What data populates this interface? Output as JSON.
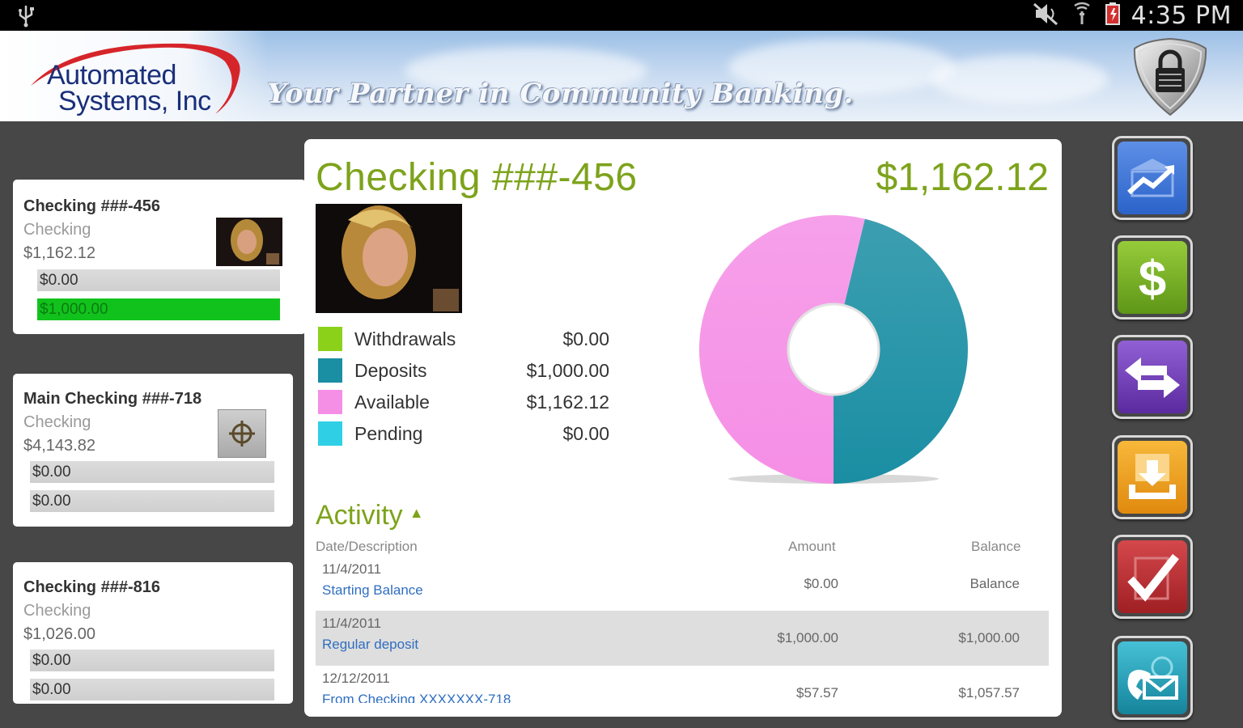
{
  "status_bar": {
    "time": "4:35 PM",
    "icons": [
      "usb-icon",
      "mute-icon",
      "signal-icon",
      "battery-icon"
    ]
  },
  "header": {
    "logo_line1": "Automated",
    "logo_line2": "Systems, Inc",
    "tagline": "Your Partner in Community Banking.",
    "lock_icon": "lock-shield-icon"
  },
  "accounts": [
    {
      "name": "Checking ###-456",
      "type": "Checking",
      "balance": "$1,162.12",
      "bar1": "$0.00",
      "bar2": "$1,000.00",
      "bar2_color": "#12c21c"
    },
    {
      "name": "Main Checking ###-718",
      "type": "Checking",
      "balance": "$4,143.82",
      "bar1": "$0.00",
      "bar2": "$0.00"
    },
    {
      "name": "Checking ###-816",
      "type": "Checking",
      "balance": "$1,026.00",
      "bar1": "$0.00",
      "bar2": "$0.00"
    }
  ],
  "detail": {
    "title": "Checking ###-456",
    "amount": "$1,162.12",
    "accent_color": "#7da31b",
    "legend": [
      {
        "label": "Withdrawals",
        "value": "$0.00",
        "color": "#8bd11a"
      },
      {
        "label": "Deposits",
        "value": "$1,000.00",
        "color": "#1a8ea3"
      },
      {
        "label": "Available",
        "value": "$1,162.12",
        "color": "#f58fe6"
      },
      {
        "label": "Pending",
        "value": "$0.00",
        "color": "#2fd0e6"
      }
    ]
  },
  "chart_data": {
    "type": "pie",
    "series": [
      {
        "name": "Deposits",
        "value": 1000.0,
        "color": "#1a8ea3"
      },
      {
        "name": "Available",
        "value": 1162.12,
        "color": "#f58fe6"
      }
    ],
    "donut": true
  },
  "activity": {
    "title": "Activity",
    "headers": {
      "desc": "Date/Description",
      "amount": "Amount",
      "balance": "Balance"
    },
    "rows": [
      {
        "date": "11/4/2011",
        "desc": "Starting Balance",
        "amount": "$0.00",
        "balance": "Balance"
      },
      {
        "date": "11/4/2011",
        "desc": "Regular deposit",
        "amount": "$1,000.00",
        "balance": "$1,000.00"
      },
      {
        "date": "12/12/2011",
        "desc": "From Checking XXXXXXX-718",
        "amount": "$57.57",
        "balance": "$1,057.57"
      }
    ]
  },
  "nav": [
    {
      "name": "accounts-icon",
      "color": "#2b63c9"
    },
    {
      "name": "dollar-icon",
      "color": "#6aa31a"
    },
    {
      "name": "transfer-icon",
      "color": "#6f36b3"
    },
    {
      "name": "deposit-icon",
      "color": "#e59515"
    },
    {
      "name": "checkmark-icon",
      "color": "#b42a2e"
    },
    {
      "name": "contact-icon",
      "color": "#1f9cb3"
    }
  ]
}
